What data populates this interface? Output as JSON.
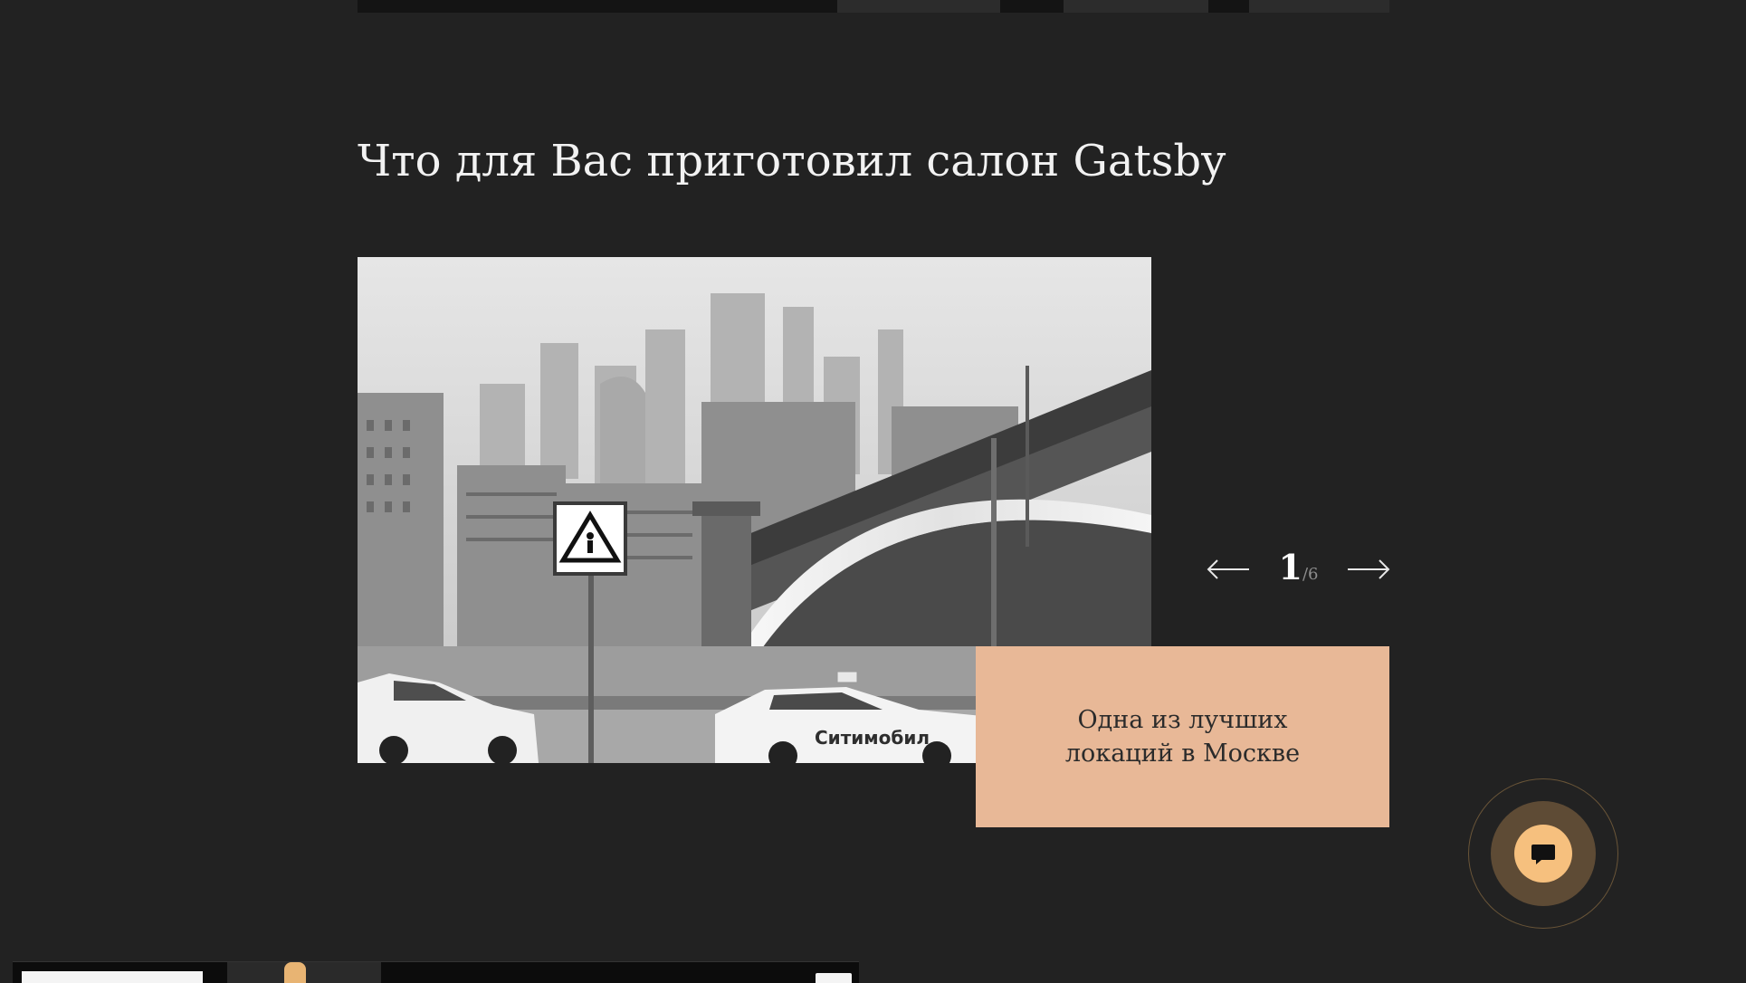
{
  "section": {
    "title": "Что для Вас приготовил салон Gatsby"
  },
  "slider": {
    "current": "1",
    "separator": "/",
    "total": "6",
    "prev_icon": "arrow-left-icon",
    "next_icon": "arrow-right-icon",
    "caption": "Одна из лучших локаций в Москве",
    "photo_text": {
      "taxi_brand": "Ситимобил"
    }
  },
  "chat": {
    "icon": "chat-bubble-icon"
  },
  "colors": {
    "background": "#222222",
    "caption_bg": "#e8b897",
    "chat_accent": "#f6c07e",
    "chat_ring": "#5e4b35"
  }
}
